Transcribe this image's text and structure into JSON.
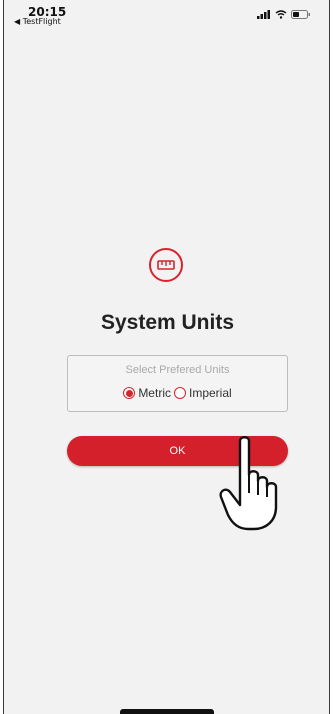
{
  "status_bar": {
    "time": "20:15",
    "back_app": "◀ TestFlight",
    "icons": [
      "signal-icon",
      "wifi-icon",
      "battery-icon"
    ]
  },
  "dialog": {
    "icon": "ruler-icon",
    "title": "System Units",
    "units_caption": "Select Prefered Units",
    "options": [
      {
        "label": "Metric",
        "selected": true
      },
      {
        "label": "Imperial",
        "selected": false
      }
    ],
    "ok_label": "OK"
  },
  "colors": {
    "accent": "#d4202a",
    "background": "#f2f2f2"
  }
}
